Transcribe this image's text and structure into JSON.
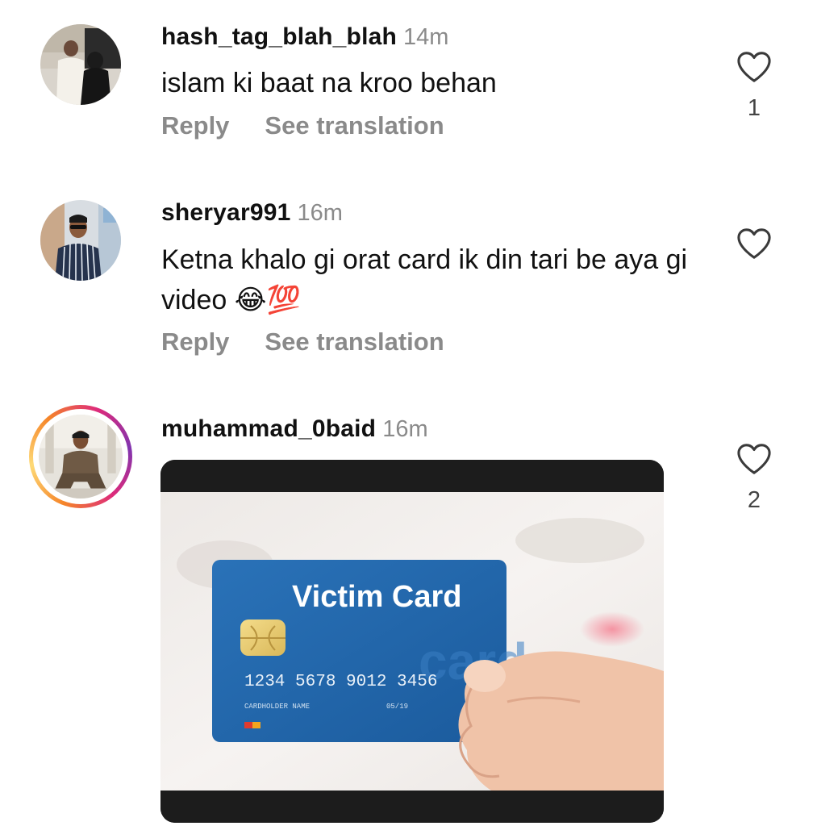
{
  "comments": [
    {
      "username": "hash_tag_blah_blah",
      "time": "14m",
      "text": "islam ki baat na kroo behan",
      "reply_label": "Reply",
      "translate_label": "See translation",
      "likes": "1",
      "avatar": "avatar-photo"
    },
    {
      "username": "sheryar991",
      "time": "16m",
      "text": "Ketna khalo gi orat card ik din tari be aya gi video 😂💯",
      "reply_label": "Reply",
      "translate_label": "See translation",
      "likes": "",
      "avatar": "avatar-photo"
    },
    {
      "username": "muhammad_0baid",
      "time": "16m",
      "likes": "2",
      "avatar": "avatar-photo-story-ring",
      "media": {
        "card_title": "Victim Card",
        "card_number": "1234 5678 9012 3456",
        "cardholder_label": "CARDHOLDER NAME",
        "expiry": "05/19",
        "watermark": "card"
      }
    }
  ],
  "colors": {
    "muted": "#8a8a8a",
    "card_blue": "#1f63a8",
    "story_ring": "#dd2a7b"
  },
  "icons": {
    "like": "heart-outline-icon"
  }
}
